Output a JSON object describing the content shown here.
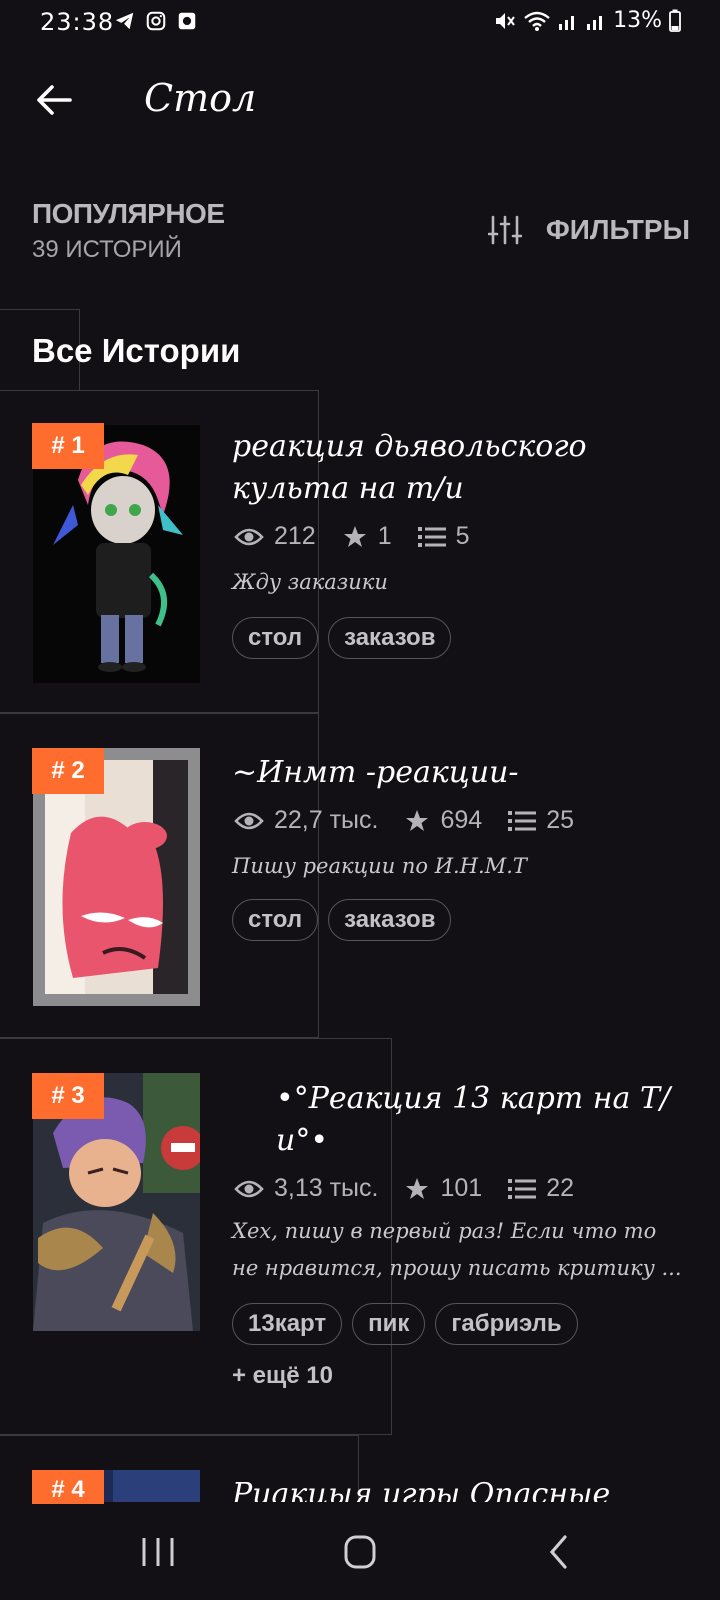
{
  "status_bar": {
    "time": "23:38",
    "battery": "13%",
    "left_icons": [
      "telegram-icon",
      "instagram-icon",
      "app-notification-icon"
    ],
    "right_icons": [
      "mute-icon",
      "wifi-icon",
      "signal-icon",
      "signal-icon",
      "battery-icon"
    ]
  },
  "app_bar": {
    "title": "Стол",
    "back_icon": "arrow-left-icon"
  },
  "section": {
    "title": "ПОПУЛЯРНОЕ",
    "count": "39 ИСТОРИЙ",
    "filters_label": "ФИЛЬТРЫ",
    "filters_icon": "sliders-icon"
  },
  "tab": {
    "label": "Все Истории"
  },
  "stories": [
    {
      "rank": "# 1",
      "title": "реакция дьявольского культа на т/и",
      "views": "212",
      "stars": "1",
      "parts": "5",
      "description": "Жду заказики",
      "tags": [
        "стол",
        "заказов"
      ],
      "more": ""
    },
    {
      "rank": "# 2",
      "title": "~Инмт -реакции-",
      "views": "22,7 тыс.",
      "stars": "694",
      "parts": "25",
      "description": "Пишу реакции по И.Н.М.Т",
      "tags": [
        "стол",
        "заказов"
      ],
      "more": ""
    },
    {
      "rank": "# 3",
      "title": "•°Реакция 13 карт на Т/и°•",
      "views": "3,13 тыс.",
      "stars": "101",
      "parts": "22",
      "description": "Хех, пишу в первый раз! Если что то не нравится, прошу писать критику ...",
      "tags": [
        "13карт",
        "пик",
        "габриэль"
      ],
      "more": "+ ещё 10"
    },
    {
      "rank": "# 4",
      "title": "Риакцыя игры Опасные",
      "views": "",
      "stars": "",
      "parts": "",
      "description": "",
      "tags": [],
      "more": ""
    }
  ],
  "colors": {
    "background": "#121014",
    "rank_badge": "#ff6d2e",
    "muted_text": "#b4b4b8"
  },
  "nav_bar": {
    "icons": [
      "recent-apps-icon",
      "home-icon",
      "back-icon"
    ]
  }
}
